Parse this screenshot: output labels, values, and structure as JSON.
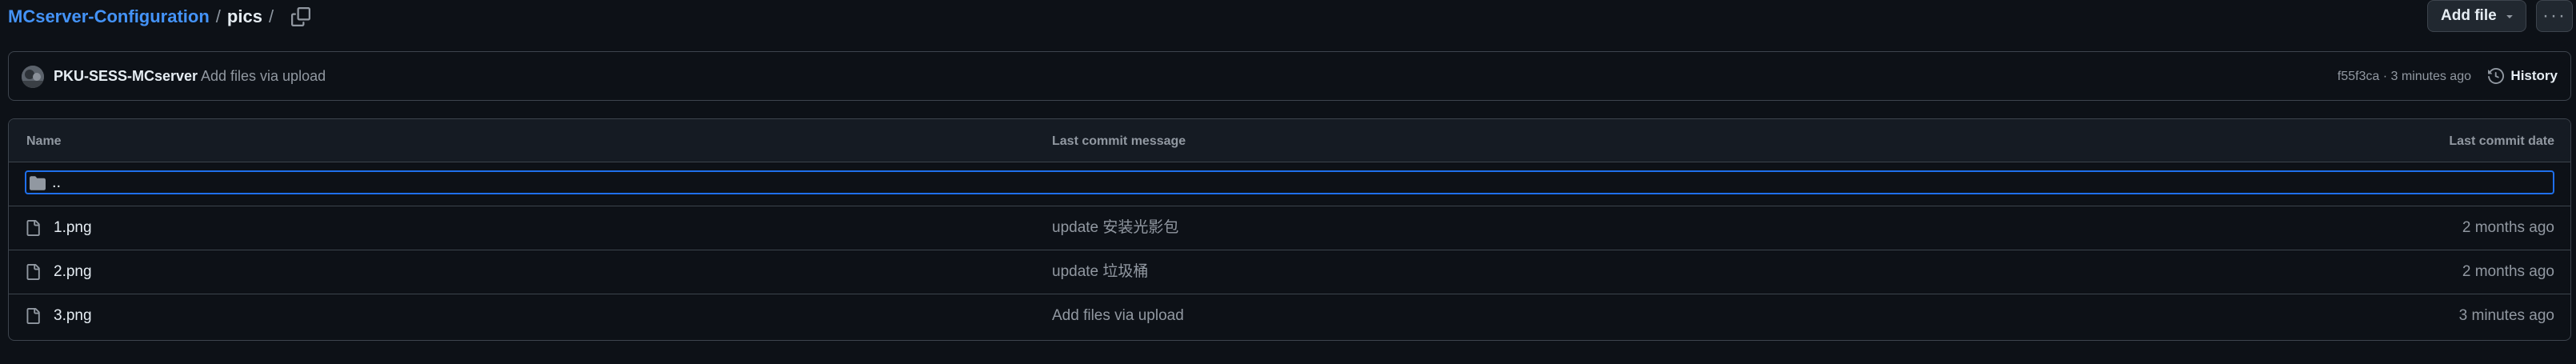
{
  "breadcrumb": {
    "repo": "MCserver-Configuration",
    "separator": "/",
    "current": "pics",
    "trailing": "/"
  },
  "actions": {
    "add_file_label": "Add file",
    "more_label": "···"
  },
  "commit": {
    "author": "PKU-SESS-MCserver",
    "message": "Add files via upload",
    "meta": "f55f3ca · 3 minutes ago",
    "history_label": "History"
  },
  "table": {
    "headers": {
      "name": "Name",
      "message": "Last commit message",
      "date": "Last commit date"
    },
    "parent_label": "..",
    "rows": [
      {
        "name": "1.png",
        "message": "update 安装光影包",
        "date": "2 months ago"
      },
      {
        "name": "2.png",
        "message": "update 垃圾桶",
        "date": "2 months ago"
      },
      {
        "name": "3.png",
        "message": "Add files via upload",
        "date": "3 minutes ago"
      }
    ]
  },
  "colors": {
    "background": "#0d1117",
    "link": "#4493f8",
    "border": "#3d444d",
    "muted": "#9198a1",
    "focus": "#1f6feb"
  }
}
